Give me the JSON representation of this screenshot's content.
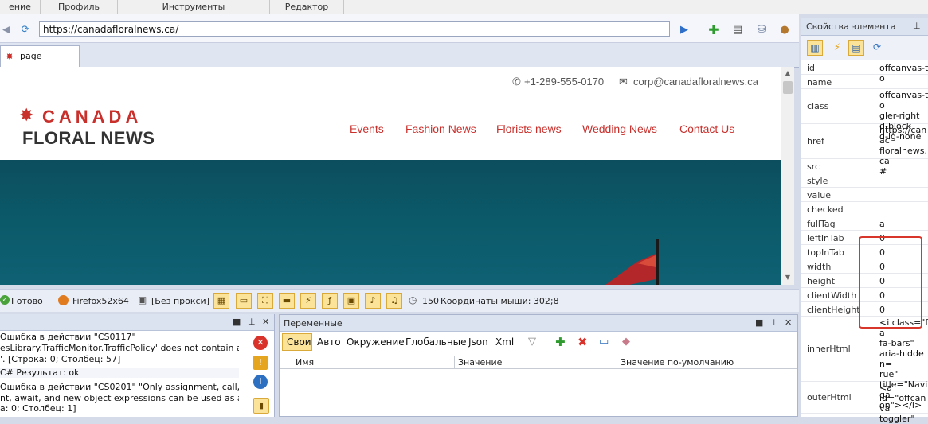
{
  "menu": {
    "items": [
      "ение",
      "Профиль",
      "Инструменты",
      "Редактор"
    ]
  },
  "toolbar": {
    "url": "https://canadafloralnews.ca/"
  },
  "tabs": {
    "page_label": "page"
  },
  "site": {
    "phone": "+1-289-555-0170",
    "email": "corp@canadafloralnews.ca",
    "logo_top": "CANADA",
    "logo_bottom": "FLORAL NEWS",
    "nav": [
      "Events",
      "Fashion News",
      "Florists news",
      "Wedding News",
      "Contact Us"
    ]
  },
  "status": {
    "ready": "Готово",
    "browser": "Firefox52x64",
    "proxy": "[Без прокси]",
    "timer": "150",
    "coords": "Координаты мыши: 302;8"
  },
  "log": {
    "lines": [
      "Ошибка в действии \"CS0117\"",
      "esLibrary.TrafficMonitor.TrafficPolicy' does not contain a",
      "'. [Строка: 0; Столбец: 57]",
      "C#  Результат: ok",
      "Ошибка в действии \"CS0201\" \"Only assignment, call,",
      "nt, await, and new object expressions can be used as a",
      "а: 0; Столбец: 1]"
    ]
  },
  "variables": {
    "title": "Переменные",
    "tabs": [
      "Свои",
      "Авто",
      "Окружение",
      "Глобальные",
      "Json",
      "Xml"
    ],
    "columns": [
      "Имя",
      "Значение",
      "Значение по-умолчанию"
    ]
  },
  "properties": {
    "title": "Свойства элемента",
    "rows": [
      {
        "key": "id",
        "value": "offcanvas-to"
      },
      {
        "key": "name",
        "value": ""
      },
      {
        "key": "class",
        "value": "offcanvas-to\ngler-right\nd-block\nd-lg-none"
      },
      {
        "key": "href",
        "value": "https://canac\nfloralnews.ca\n#"
      },
      {
        "key": "src",
        "value": ""
      },
      {
        "key": "style",
        "value": ""
      },
      {
        "key": "value",
        "value": ""
      },
      {
        "key": "checked",
        "value": ""
      },
      {
        "key": "fullTag",
        "value": "a"
      },
      {
        "key": "leftInTab",
        "value": "0"
      },
      {
        "key": "topInTab",
        "value": "0"
      },
      {
        "key": "width",
        "value": "0"
      },
      {
        "key": "height",
        "value": "0"
      },
      {
        "key": "clientWidth",
        "value": "0"
      },
      {
        "key": "clientHeight",
        "value": "0"
      },
      {
        "key": "innerHtml",
        "value": "<i class=\"fa\nfa-bars\"\naria-hidden=\nrue\"\ntitle=\"Naviga\non\"></i>"
      },
      {
        "key": "outerHtml",
        "value": "<a\nid=\"offcanva\ntoggler\""
      }
    ]
  }
}
